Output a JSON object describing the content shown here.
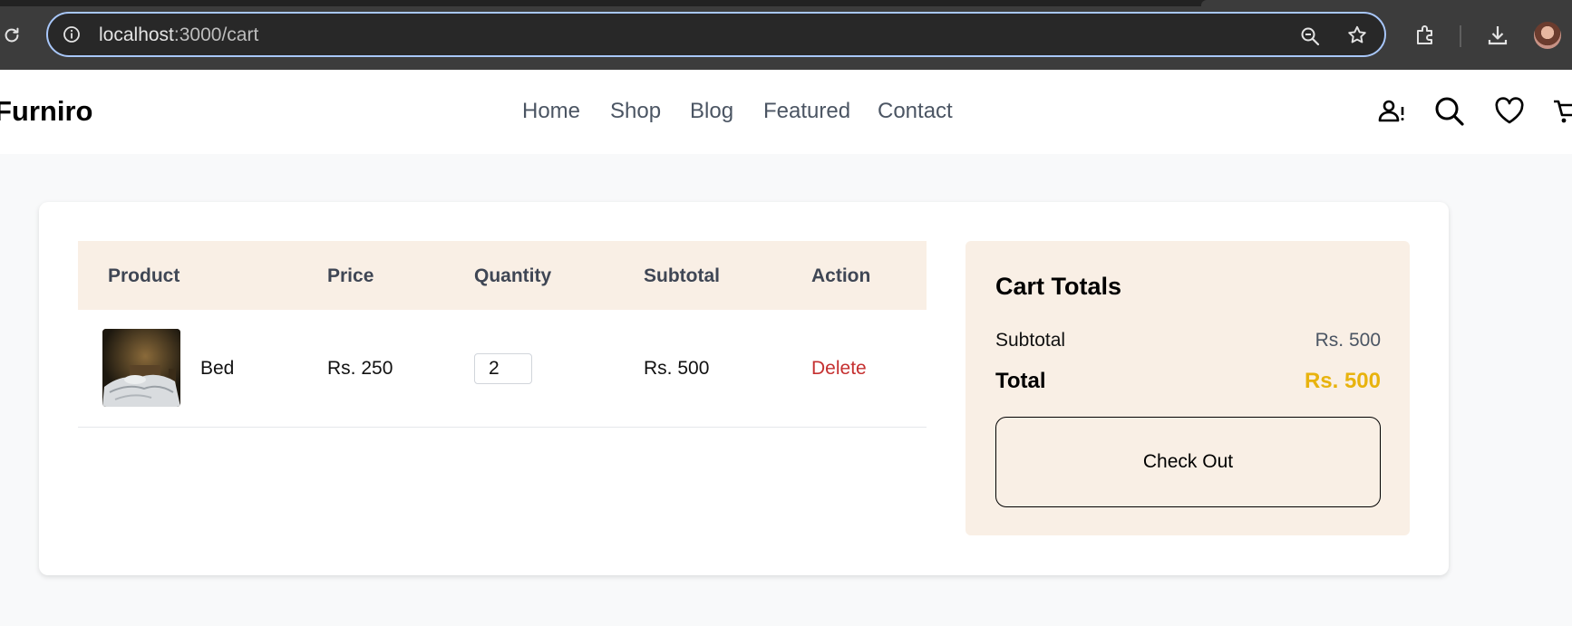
{
  "browser": {
    "url_host": "localhost",
    "url_path": ":3000/cart"
  },
  "site": {
    "logo": "Furniro",
    "nav": [
      "Home",
      "Shop",
      "Blog",
      "Featured",
      "Contact"
    ]
  },
  "cart": {
    "headers": {
      "product": "Product",
      "price": "Price",
      "quantity": "Quantity",
      "subtotal": "Subtotal",
      "action": "Action"
    },
    "items": [
      {
        "name": "Bed",
        "price": "Rs. 250",
        "quantity": "2",
        "subtotal": "Rs. 500",
        "action": "Delete"
      }
    ]
  },
  "totals": {
    "title": "Cart Totals",
    "subtotal_label": "Subtotal",
    "subtotal_value": "Rs. 500",
    "total_label": "Total",
    "total_value": "Rs. 500",
    "checkout_label": "Check Out"
  },
  "colors": {
    "accent": "#e8b30e",
    "delete": "#c53030",
    "header_bg": "#f9efe5"
  }
}
